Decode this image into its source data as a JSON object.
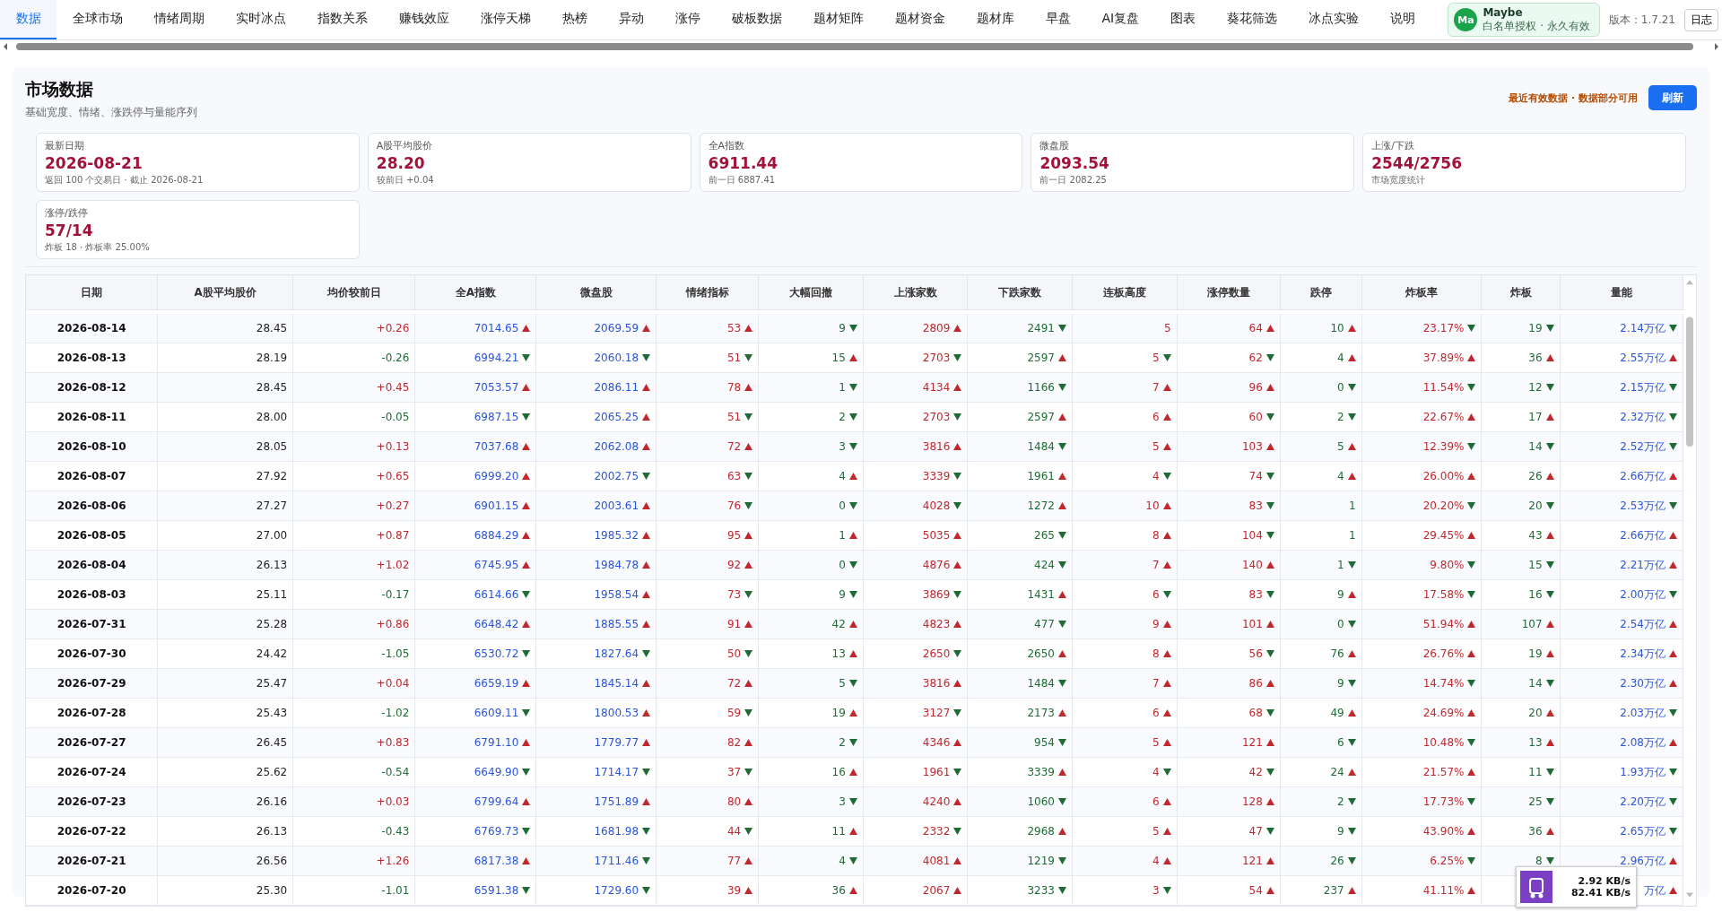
{
  "nav": {
    "tabs": [
      {
        "label": "数据",
        "selected": true
      },
      {
        "label": "全球市场",
        "selected": false
      },
      {
        "label": "情绪周期",
        "selected": false
      },
      {
        "label": "实时冰点",
        "selected": false
      },
      {
        "label": "指数关系",
        "selected": false
      },
      {
        "label": "赚钱效应",
        "selected": false
      },
      {
        "label": "涨停天梯",
        "selected": false
      },
      {
        "label": "热榜",
        "selected": false
      },
      {
        "label": "异动",
        "selected": false
      },
      {
        "label": "涨停",
        "selected": false
      },
      {
        "label": "破板数据",
        "selected": false
      },
      {
        "label": "题材矩阵",
        "selected": false
      },
      {
        "label": "题材资金",
        "selected": false
      },
      {
        "label": "题材库",
        "selected": false
      },
      {
        "label": "早盘",
        "selected": false
      },
      {
        "label": "AI复盘",
        "selected": false
      },
      {
        "label": "图表",
        "selected": false
      },
      {
        "label": "葵花筛选",
        "selected": false
      },
      {
        "label": "冰点实验",
        "selected": false
      },
      {
        "label": "说明",
        "selected": false
      }
    ],
    "user": {
      "initials": "Ma",
      "name": "Maybe",
      "license": "白名单授权 · 永久有效"
    },
    "version": "版本：1.7.21",
    "log_button": "日志"
  },
  "panel": {
    "title": "市场数据",
    "subtitle": "基础宽度、情绪、涨跌停与量能序列",
    "status": "最近有效数据 · 数据部分可用",
    "refresh_button": "刷新"
  },
  "cards": [
    {
      "label": "最新日期",
      "value": "2026-08-21",
      "note": "返回 100 个交易日 · 截止 2026-08-21"
    },
    {
      "label": "A股平均股价",
      "value": "28.20",
      "note": "较前日 +0.04"
    },
    {
      "label": "全A指数",
      "value": "6911.44",
      "note": "前一日 6887.41"
    },
    {
      "label": "微盘股",
      "value": "2093.54",
      "note": "前一日 2082.25"
    },
    {
      "label": "上涨/下跌",
      "value": "2544/2756",
      "note": "市场宽度统计"
    },
    {
      "label": "涨停/跌停",
      "value": "57/14",
      "note": "炸板 18 · 炸板率 25.00%"
    }
  ],
  "table": {
    "columns": [
      {
        "label": "日期"
      },
      {
        "label": "A股平均股价"
      },
      {
        "label": "均价较前日"
      },
      {
        "label": "全A指数"
      },
      {
        "label": "微盘股"
      },
      {
        "label": "情绪指标"
      },
      {
        "label": "大幅回撤"
      },
      {
        "label": "上涨家数"
      },
      {
        "label": "下跌家数"
      },
      {
        "label": "连板高度"
      },
      {
        "label": "涨停数量"
      },
      {
        "label": "跌停"
      },
      {
        "label": "炸板率"
      },
      {
        "label": "炸板"
      },
      {
        "label": "量能"
      }
    ],
    "rows": [
      [
        {
          "text": "2026-08-14"
        },
        {
          "text": "28.45"
        },
        {
          "text": "+0.26",
          "rising": true
        },
        {
          "text": "7014.65",
          "rising": true
        },
        {
          "text": "2069.59",
          "rising": true
        },
        {
          "text": "53",
          "rising": true
        },
        {
          "text": "9",
          "rising": false
        },
        {
          "text": "2809",
          "rising": true
        },
        {
          "text": "2491",
          "rising": false
        },
        {
          "text": "5"
        },
        {
          "text": "64",
          "rising": true
        },
        {
          "text": "10",
          "rising": true
        },
        {
          "text": "23.17%",
          "rising": false
        },
        {
          "text": "19",
          "rising": false
        },
        {
          "text": "2.14万亿",
          "rising": false
        }
      ],
      [
        {
          "text": "2026-08-13"
        },
        {
          "text": "28.19"
        },
        {
          "text": "-0.26",
          "rising": false
        },
        {
          "text": "6994.21",
          "rising": false
        },
        {
          "text": "2060.18",
          "rising": false
        },
        {
          "text": "51",
          "rising": false
        },
        {
          "text": "15",
          "rising": true
        },
        {
          "text": "2703",
          "rising": false
        },
        {
          "text": "2597",
          "rising": true
        },
        {
          "text": "5",
          "rising": false
        },
        {
          "text": "62",
          "rising": false
        },
        {
          "text": "4",
          "rising": true
        },
        {
          "text": "37.89%",
          "rising": true
        },
        {
          "text": "36",
          "rising": true
        },
        {
          "text": "2.55万亿",
          "rising": true
        }
      ],
      [
        {
          "text": "2026-08-12"
        },
        {
          "text": "28.45"
        },
        {
          "text": "+0.45",
          "rising": true
        },
        {
          "text": "7053.57",
          "rising": true
        },
        {
          "text": "2086.11",
          "rising": true
        },
        {
          "text": "78",
          "rising": true
        },
        {
          "text": "1",
          "rising": false
        },
        {
          "text": "4134",
          "rising": true
        },
        {
          "text": "1166",
          "rising": false
        },
        {
          "text": "7",
          "rising": true
        },
        {
          "text": "96",
          "rising": true
        },
        {
          "text": "0",
          "rising": false
        },
        {
          "text": "11.54%",
          "rising": false
        },
        {
          "text": "12",
          "rising": false
        },
        {
          "text": "2.15万亿",
          "rising": false
        }
      ],
      [
        {
          "text": "2026-08-11"
        },
        {
          "text": "28.00"
        },
        {
          "text": "-0.05",
          "rising": false
        },
        {
          "text": "6987.15",
          "rising": false
        },
        {
          "text": "2065.25",
          "rising": true
        },
        {
          "text": "51",
          "rising": false
        },
        {
          "text": "2",
          "rising": false
        },
        {
          "text": "2703",
          "rising": false
        },
        {
          "text": "2597",
          "rising": true
        },
        {
          "text": "6",
          "rising": true
        },
        {
          "text": "60",
          "rising": false
        },
        {
          "text": "2",
          "rising": false
        },
        {
          "text": "22.67%",
          "rising": true
        },
        {
          "text": "17",
          "rising": true
        },
        {
          "text": "2.32万亿",
          "rising": false
        }
      ],
      [
        {
          "text": "2026-08-10"
        },
        {
          "text": "28.05"
        },
        {
          "text": "+0.13",
          "rising": true
        },
        {
          "text": "7037.68",
          "rising": true
        },
        {
          "text": "2062.08",
          "rising": true
        },
        {
          "text": "72",
          "rising": true
        },
        {
          "text": "3",
          "rising": false
        },
        {
          "text": "3816",
          "rising": true
        },
        {
          "text": "1484",
          "rising": false
        },
        {
          "text": "5",
          "rising": true
        },
        {
          "text": "103",
          "rising": true
        },
        {
          "text": "5",
          "rising": true
        },
        {
          "text": "12.39%",
          "rising": false
        },
        {
          "text": "14",
          "rising": false
        },
        {
          "text": "2.52万亿",
          "rising": false
        }
      ],
      [
        {
          "text": "2026-08-07"
        },
        {
          "text": "27.92"
        },
        {
          "text": "+0.65",
          "rising": true
        },
        {
          "text": "6999.20",
          "rising": true
        },
        {
          "text": "2002.75",
          "rising": false
        },
        {
          "text": "63",
          "rising": false
        },
        {
          "text": "4",
          "rising": true
        },
        {
          "text": "3339",
          "rising": false
        },
        {
          "text": "1961",
          "rising": true
        },
        {
          "text": "4",
          "rising": false
        },
        {
          "text": "74",
          "rising": false
        },
        {
          "text": "4",
          "rising": true
        },
        {
          "text": "26.00%",
          "rising": true
        },
        {
          "text": "26",
          "rising": true
        },
        {
          "text": "2.66万亿",
          "rising": true
        }
      ],
      [
        {
          "text": "2026-08-06"
        },
        {
          "text": "27.27"
        },
        {
          "text": "+0.27",
          "rising": true
        },
        {
          "text": "6901.15",
          "rising": true
        },
        {
          "text": "2003.61",
          "rising": true
        },
        {
          "text": "76",
          "rising": false
        },
        {
          "text": "0",
          "rising": false
        },
        {
          "text": "4028",
          "rising": false
        },
        {
          "text": "1272",
          "rising": true
        },
        {
          "text": "10",
          "rising": true
        },
        {
          "text": "83",
          "rising": false
        },
        {
          "text": "1"
        },
        {
          "text": "20.20%",
          "rising": false
        },
        {
          "text": "20",
          "rising": false
        },
        {
          "text": "2.53万亿",
          "rising": false
        }
      ],
      [
        {
          "text": "2026-08-05"
        },
        {
          "text": "27.00"
        },
        {
          "text": "+0.87",
          "rising": true
        },
        {
          "text": "6884.29",
          "rising": true
        },
        {
          "text": "1985.32",
          "rising": true
        },
        {
          "text": "95",
          "rising": true
        },
        {
          "text": "1",
          "rising": true
        },
        {
          "text": "5035",
          "rising": true
        },
        {
          "text": "265",
          "rising": false
        },
        {
          "text": "8",
          "rising": true
        },
        {
          "text": "104",
          "rising": false
        },
        {
          "text": "1"
        },
        {
          "text": "29.45%",
          "rising": true
        },
        {
          "text": "43",
          "rising": true
        },
        {
          "text": "2.66万亿",
          "rising": true
        }
      ],
      [
        {
          "text": "2026-08-04"
        },
        {
          "text": "26.13"
        },
        {
          "text": "+1.02",
          "rising": true
        },
        {
          "text": "6745.95",
          "rising": true
        },
        {
          "text": "1984.78",
          "rising": true
        },
        {
          "text": "92",
          "rising": true
        },
        {
          "text": "0",
          "rising": false
        },
        {
          "text": "4876",
          "rising": true
        },
        {
          "text": "424",
          "rising": false
        },
        {
          "text": "7",
          "rising": true
        },
        {
          "text": "140",
          "rising": true
        },
        {
          "text": "1",
          "rising": false
        },
        {
          "text": "9.80%",
          "rising": false
        },
        {
          "text": "15",
          "rising": false
        },
        {
          "text": "2.21万亿",
          "rising": true
        }
      ],
      [
        {
          "text": "2026-08-03"
        },
        {
          "text": "25.11"
        },
        {
          "text": "-0.17",
          "rising": false
        },
        {
          "text": "6614.66",
          "rising": false
        },
        {
          "text": "1958.54",
          "rising": true
        },
        {
          "text": "73",
          "rising": false
        },
        {
          "text": "9",
          "rising": false
        },
        {
          "text": "3869",
          "rising": false
        },
        {
          "text": "1431",
          "rising": true
        },
        {
          "text": "6",
          "rising": false
        },
        {
          "text": "83",
          "rising": false
        },
        {
          "text": "9",
          "rising": true
        },
        {
          "text": "17.58%",
          "rising": false
        },
        {
          "text": "16",
          "rising": false
        },
        {
          "text": "2.00万亿",
          "rising": false
        }
      ],
      [
        {
          "text": "2026-07-31"
        },
        {
          "text": "25.28"
        },
        {
          "text": "+0.86",
          "rising": true
        },
        {
          "text": "6648.42",
          "rising": true
        },
        {
          "text": "1885.55",
          "rising": true
        },
        {
          "text": "91",
          "rising": true
        },
        {
          "text": "42",
          "rising": true
        },
        {
          "text": "4823",
          "rising": true
        },
        {
          "text": "477",
          "rising": false
        },
        {
          "text": "9",
          "rising": true
        },
        {
          "text": "101",
          "rising": true
        },
        {
          "text": "0",
          "rising": false
        },
        {
          "text": "51.94%",
          "rising": true
        },
        {
          "text": "107",
          "rising": true
        },
        {
          "text": "2.54万亿",
          "rising": true
        }
      ],
      [
        {
          "text": "2026-07-30"
        },
        {
          "text": "24.42"
        },
        {
          "text": "-1.05",
          "rising": false
        },
        {
          "text": "6530.72",
          "rising": false
        },
        {
          "text": "1827.64",
          "rising": false
        },
        {
          "text": "50",
          "rising": false
        },
        {
          "text": "13",
          "rising": true
        },
        {
          "text": "2650",
          "rising": false
        },
        {
          "text": "2650",
          "rising": true
        },
        {
          "text": "8",
          "rising": true
        },
        {
          "text": "56",
          "rising": false
        },
        {
          "text": "76",
          "rising": true
        },
        {
          "text": "26.76%",
          "rising": true
        },
        {
          "text": "19",
          "rising": true
        },
        {
          "text": "2.34万亿",
          "rising": true
        }
      ],
      [
        {
          "text": "2026-07-29"
        },
        {
          "text": "25.47"
        },
        {
          "text": "+0.04",
          "rising": true
        },
        {
          "text": "6659.19",
          "rising": true
        },
        {
          "text": "1845.14",
          "rising": true
        },
        {
          "text": "72",
          "rising": true
        },
        {
          "text": "5",
          "rising": false
        },
        {
          "text": "3816",
          "rising": true
        },
        {
          "text": "1484",
          "rising": false
        },
        {
          "text": "7",
          "rising": true
        },
        {
          "text": "86",
          "rising": true
        },
        {
          "text": "9",
          "rising": false
        },
        {
          "text": "14.74%",
          "rising": false
        },
        {
          "text": "14",
          "rising": false
        },
        {
          "text": "2.30万亿",
          "rising": true
        }
      ],
      [
        {
          "text": "2026-07-28"
        },
        {
          "text": "25.43"
        },
        {
          "text": "-1.02",
          "rising": false
        },
        {
          "text": "6609.11",
          "rising": false
        },
        {
          "text": "1800.53",
          "rising": true
        },
        {
          "text": "59",
          "rising": false
        },
        {
          "text": "19",
          "rising": true
        },
        {
          "text": "3127",
          "rising": false
        },
        {
          "text": "2173",
          "rising": true
        },
        {
          "text": "6",
          "rising": true
        },
        {
          "text": "68",
          "rising": false
        },
        {
          "text": "49",
          "rising": true
        },
        {
          "text": "24.69%",
          "rising": true
        },
        {
          "text": "20",
          "rising": true
        },
        {
          "text": "2.03万亿",
          "rising": false
        }
      ],
      [
        {
          "text": "2026-07-27"
        },
        {
          "text": "26.45"
        },
        {
          "text": "+0.83",
          "rising": true
        },
        {
          "text": "6791.10",
          "rising": true
        },
        {
          "text": "1779.77",
          "rising": true
        },
        {
          "text": "82",
          "rising": true
        },
        {
          "text": "2",
          "rising": false
        },
        {
          "text": "4346",
          "rising": true
        },
        {
          "text": "954",
          "rising": false
        },
        {
          "text": "5",
          "rising": true
        },
        {
          "text": "121",
          "rising": true
        },
        {
          "text": "6",
          "rising": false
        },
        {
          "text": "10.48%",
          "rising": false
        },
        {
          "text": "13",
          "rising": true
        },
        {
          "text": "2.08万亿",
          "rising": true
        }
      ],
      [
        {
          "text": "2026-07-24"
        },
        {
          "text": "25.62"
        },
        {
          "text": "-0.54",
          "rising": false
        },
        {
          "text": "6649.90",
          "rising": false
        },
        {
          "text": "1714.17",
          "rising": false
        },
        {
          "text": "37",
          "rising": false
        },
        {
          "text": "16",
          "rising": true
        },
        {
          "text": "1961",
          "rising": false
        },
        {
          "text": "3339",
          "rising": true
        },
        {
          "text": "4",
          "rising": false
        },
        {
          "text": "42",
          "rising": false
        },
        {
          "text": "24",
          "rising": true
        },
        {
          "text": "21.57%",
          "rising": true
        },
        {
          "text": "11",
          "rising": false
        },
        {
          "text": "1.93万亿",
          "rising": false
        }
      ],
      [
        {
          "text": "2026-07-23"
        },
        {
          "text": "26.16"
        },
        {
          "text": "+0.03",
          "rising": true
        },
        {
          "text": "6799.64",
          "rising": true
        },
        {
          "text": "1751.89",
          "rising": true
        },
        {
          "text": "80",
          "rising": true
        },
        {
          "text": "3",
          "rising": false
        },
        {
          "text": "4240",
          "rising": true
        },
        {
          "text": "1060",
          "rising": false
        },
        {
          "text": "6",
          "rising": true
        },
        {
          "text": "128",
          "rising": true
        },
        {
          "text": "2",
          "rising": false
        },
        {
          "text": "17.73%",
          "rising": false
        },
        {
          "text": "25",
          "rising": false
        },
        {
          "text": "2.20万亿",
          "rising": false
        }
      ],
      [
        {
          "text": "2026-07-22"
        },
        {
          "text": "26.13"
        },
        {
          "text": "-0.43",
          "rising": false
        },
        {
          "text": "6769.73",
          "rising": false
        },
        {
          "text": "1681.98",
          "rising": false
        },
        {
          "text": "44",
          "rising": false
        },
        {
          "text": "11",
          "rising": true
        },
        {
          "text": "2332",
          "rising": false
        },
        {
          "text": "2968",
          "rising": true
        },
        {
          "text": "5",
          "rising": true
        },
        {
          "text": "47",
          "rising": false
        },
        {
          "text": "9",
          "rising": false
        },
        {
          "text": "43.90%",
          "rising": true
        },
        {
          "text": "36",
          "rising": true
        },
        {
          "text": "2.65万亿",
          "rising": false
        }
      ],
      [
        {
          "text": "2026-07-21"
        },
        {
          "text": "26.56"
        },
        {
          "text": "+1.26",
          "rising": true
        },
        {
          "text": "6817.38",
          "rising": true
        },
        {
          "text": "1711.46",
          "rising": false
        },
        {
          "text": "77",
          "rising": true
        },
        {
          "text": "4",
          "rising": false
        },
        {
          "text": "4081",
          "rising": true
        },
        {
          "text": "1219",
          "rising": false
        },
        {
          "text": "4",
          "rising": true
        },
        {
          "text": "121",
          "rising": true
        },
        {
          "text": "26",
          "rising": false
        },
        {
          "text": "6.25%",
          "rising": false
        },
        {
          "text": "8",
          "rising": false
        },
        {
          "text": "2.96万亿",
          "rising": true
        }
      ],
      [
        {
          "text": "2026-07-20"
        },
        {
          "text": "25.30"
        },
        {
          "text": "-1.01",
          "rising": false
        },
        {
          "text": "6591.38",
          "rising": false
        },
        {
          "text": "1729.60",
          "rising": false
        },
        {
          "text": "39",
          "rising": true
        },
        {
          "text": "36",
          "rising": true
        },
        {
          "text": "2067",
          "rising": true
        },
        {
          "text": "3233",
          "rising": false
        },
        {
          "text": "3",
          "rising": false
        },
        {
          "text": "54",
          "rising": true
        },
        {
          "text": "237",
          "rising": true
        },
        {
          "text": "41.11%",
          "rising": true
        },
        null,
        {
          "text": "万亿",
          "rising": true
        }
      ]
    ]
  },
  "net_speed": {
    "upload": "2.92 KB/s",
    "download": "82.41 KB/s"
  }
}
